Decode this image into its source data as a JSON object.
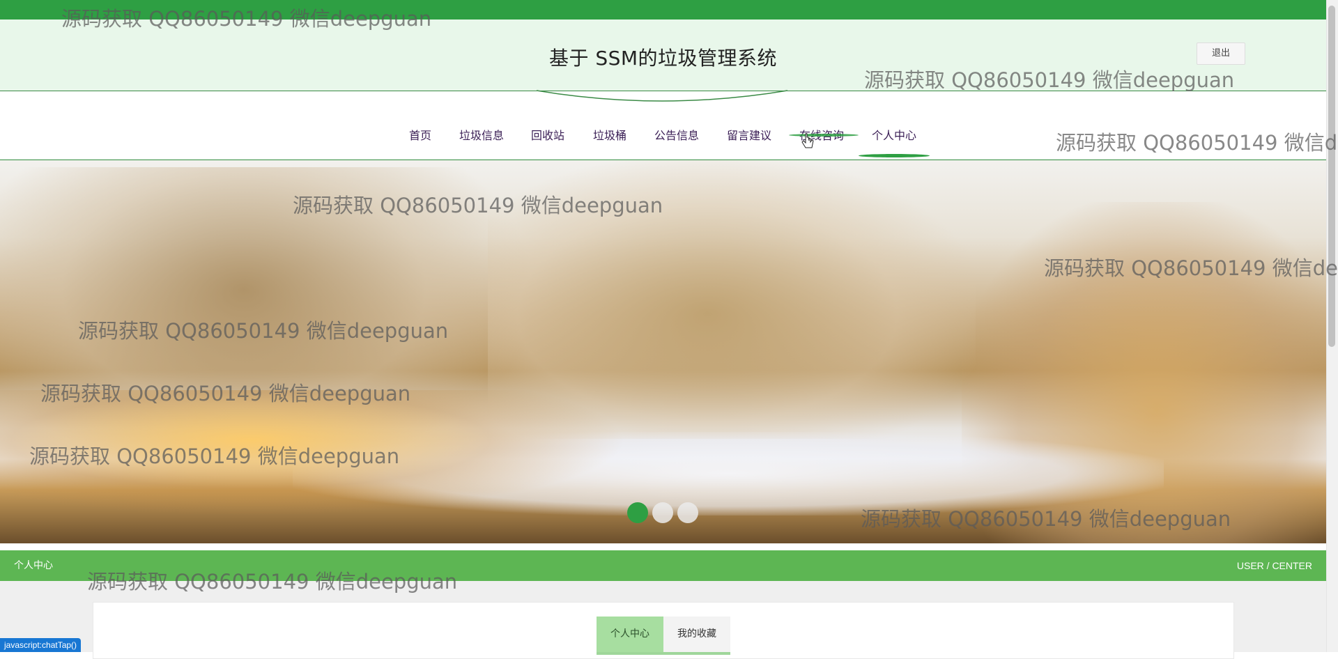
{
  "header": {
    "title": "基于 SSM的垃圾管理系统",
    "logout_label": "退出"
  },
  "nav": {
    "items": [
      {
        "label": "首页"
      },
      {
        "label": "垃圾信息"
      },
      {
        "label": "回收站"
      },
      {
        "label": "垃圾桶"
      },
      {
        "label": "公告信息"
      },
      {
        "label": "留言建议"
      },
      {
        "label": "在线咨询"
      },
      {
        "label": "个人中心"
      }
    ],
    "active": "个人中心",
    "hovered": "在线咨询"
  },
  "banner": {
    "slide_dots": 3,
    "active_slide": 1
  },
  "section": {
    "title": "个人中心",
    "subtitle": "USER / CENTER"
  },
  "tabs": [
    {
      "label": "个人中心",
      "active": true
    },
    {
      "label": "我的收藏",
      "active": false
    }
  ],
  "statusbar": {
    "text": "javascript:chatTap()"
  },
  "watermark": {
    "text": "源码获取 QQ86050149 微信deepguan"
  },
  "colors": {
    "primary": "#2e9f43",
    "section_bar": "#5db653",
    "header_bg": "#e8f7ea",
    "tab_active": "#a7dea0",
    "status_pill": "#1877d3"
  }
}
